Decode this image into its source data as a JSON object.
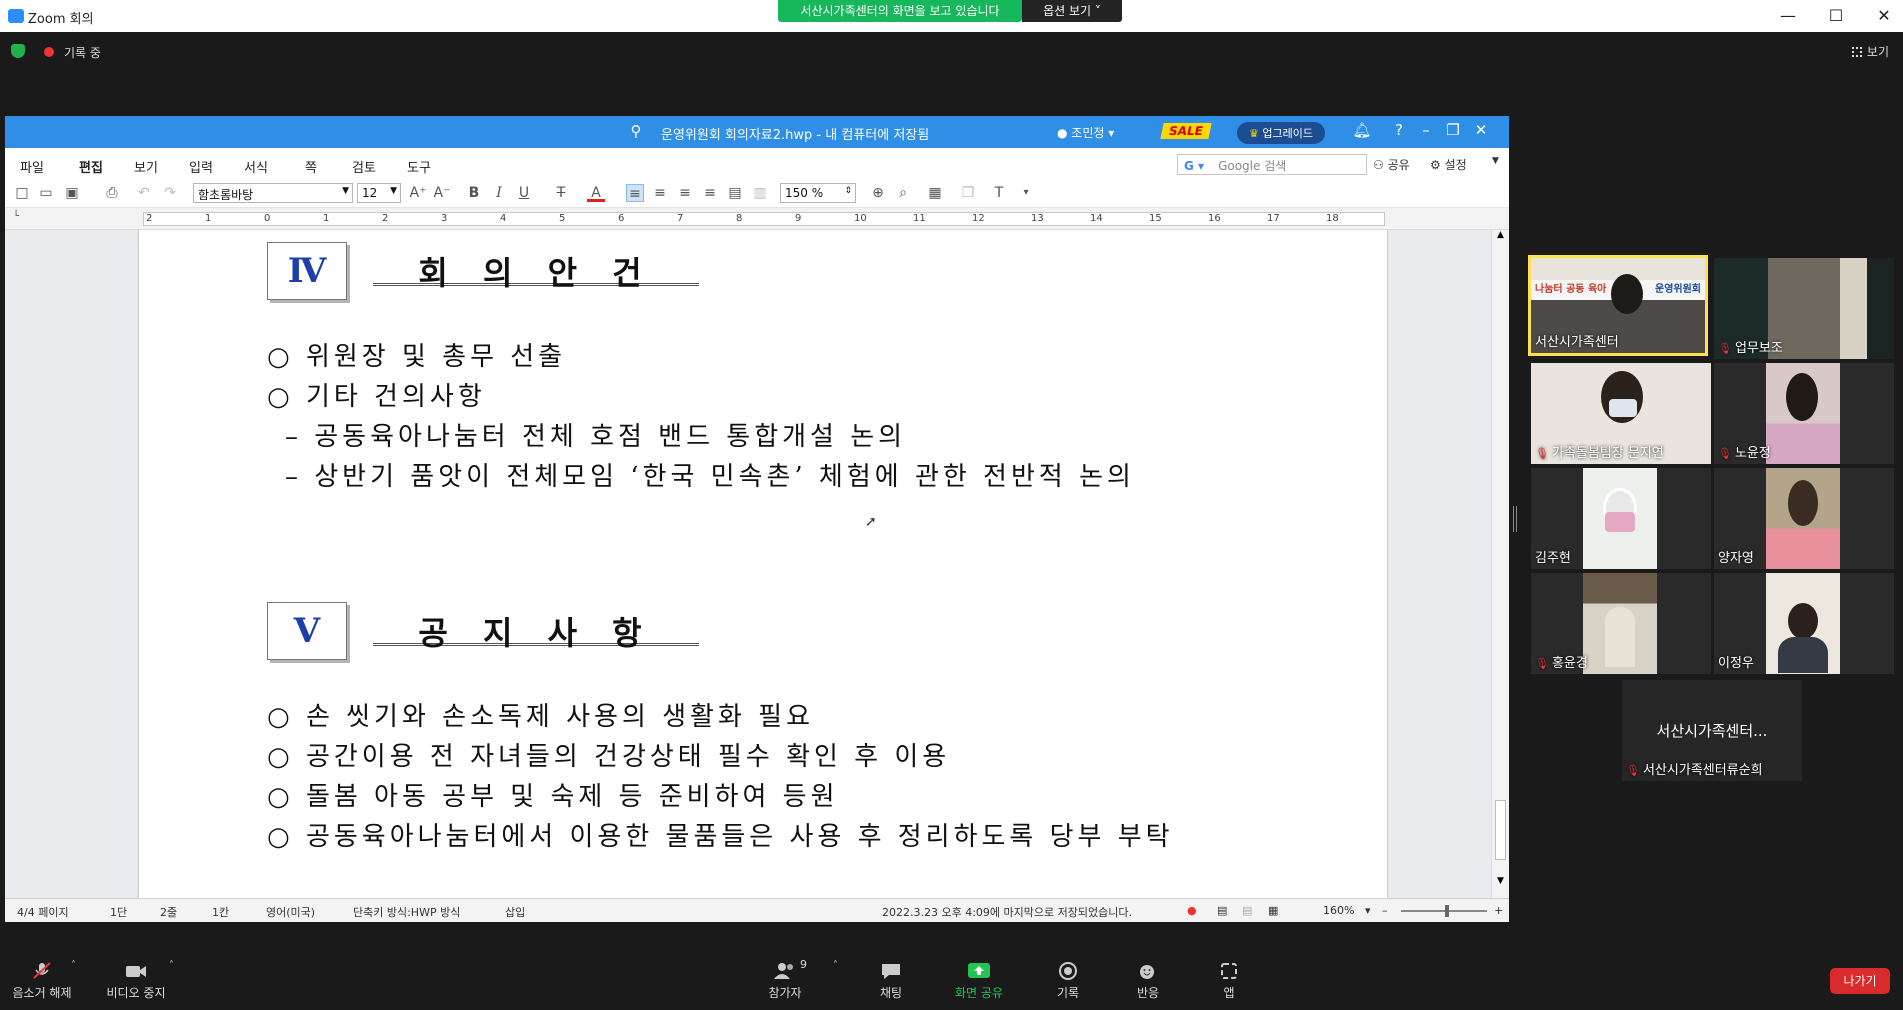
{
  "zoom": {
    "window_title": "Zoom 회의",
    "share_banner": "서산시가족센터의 화면을 보고 있습니다",
    "options_label": "옵션 보기",
    "recording_label": "기록 중",
    "view_label": "보기"
  },
  "hwp": {
    "doc_title": "운영위원회 회의자료2.hwp - 내 컴퓨터에 저장됨",
    "user_name": "조민정",
    "sale_badge": "SALE",
    "upgrade_label": "업그레이드",
    "menu": [
      "파일",
      "편집",
      "보기",
      "입력",
      "서식",
      "쪽",
      "검토",
      "도구"
    ],
    "search_placeholder": "Google 검색",
    "share_label": "공유",
    "settings_label": "설정",
    "font_name": "함초롬바탕",
    "font_size": "12",
    "zoom_value": "150 %",
    "ruler_numbers": [
      "2",
      "1",
      "0",
      "1",
      "2",
      "3",
      "4",
      "5",
      "6",
      "7",
      "8",
      "9",
      "10",
      "11",
      "12",
      "13",
      "14",
      "15",
      "16",
      "17",
      "18"
    ],
    "sections": [
      {
        "numeral": "Ⅳ",
        "title": "회 의 안 건",
        "lines": [
          "○ 위원장 및 총무 선출",
          "○ 기타 건의사항",
          "  – 공동육아나눔터 전체 호점 밴드 통합개설 논의",
          "  – 상반기 품앗이 전체모임 ‘한국 민속촌’ 체험에 관한 전반적 논의"
        ]
      },
      {
        "numeral": "Ⅴ",
        "title": "공 지 사 항",
        "lines": [
          "○ 손 씻기와 손소독제 사용의 생활화 필요",
          "○ 공간이용 전 자녀들의 건강상태 필수 확인 후 이용",
          "○ 돌봄 아동 공부 및 숙제 등 준비하여 등원",
          "○ 공동육아나눔터에서 이용한 물품들은 사용 후 정리하도록 당부 부탁"
        ]
      }
    ],
    "status": {
      "page": "4/4 페이지",
      "column": "1단",
      "line": "2줄",
      "cell": "1칸",
      "lang": "영어(미국)",
      "shortcut": "단축키 방식:HWP 방식",
      "mode": "삽입",
      "saved": "2022.3.23 오후 4:09에 마지막으로 저장되었습니다.",
      "zoom": "160%"
    }
  },
  "participants": [
    {
      "name": "서산시가족센터",
      "muted": false,
      "active": true
    },
    {
      "name": "업무보조",
      "muted": true,
      "active": false
    },
    {
      "name": "가족돌봄팀장 문지연",
      "muted": true,
      "active": false
    },
    {
      "name": "노윤정",
      "muted": true,
      "active": false
    },
    {
      "name": "김주현",
      "muted": false,
      "active": false
    },
    {
      "name": "양자영",
      "muted": false,
      "active": false
    },
    {
      "name": "홍윤경",
      "muted": true,
      "active": false
    },
    {
      "name": "이정우",
      "muted": false,
      "active": false
    }
  ],
  "extra_participant": {
    "title": "서산시가족센터...",
    "name": "서산시가족센터류순희"
  },
  "banner_text": "운영위원회",
  "banner_text_left": "나눔터 공동 육아",
  "toolbar": {
    "unmute": "음소거 해제",
    "stop_video": "비디오 중지",
    "participants": "참가자",
    "participant_count": "9",
    "chat": "채팅",
    "share_screen": "화면 공유",
    "record": "기록",
    "reactions": "반응",
    "apps": "앱",
    "leave": "나가기"
  }
}
